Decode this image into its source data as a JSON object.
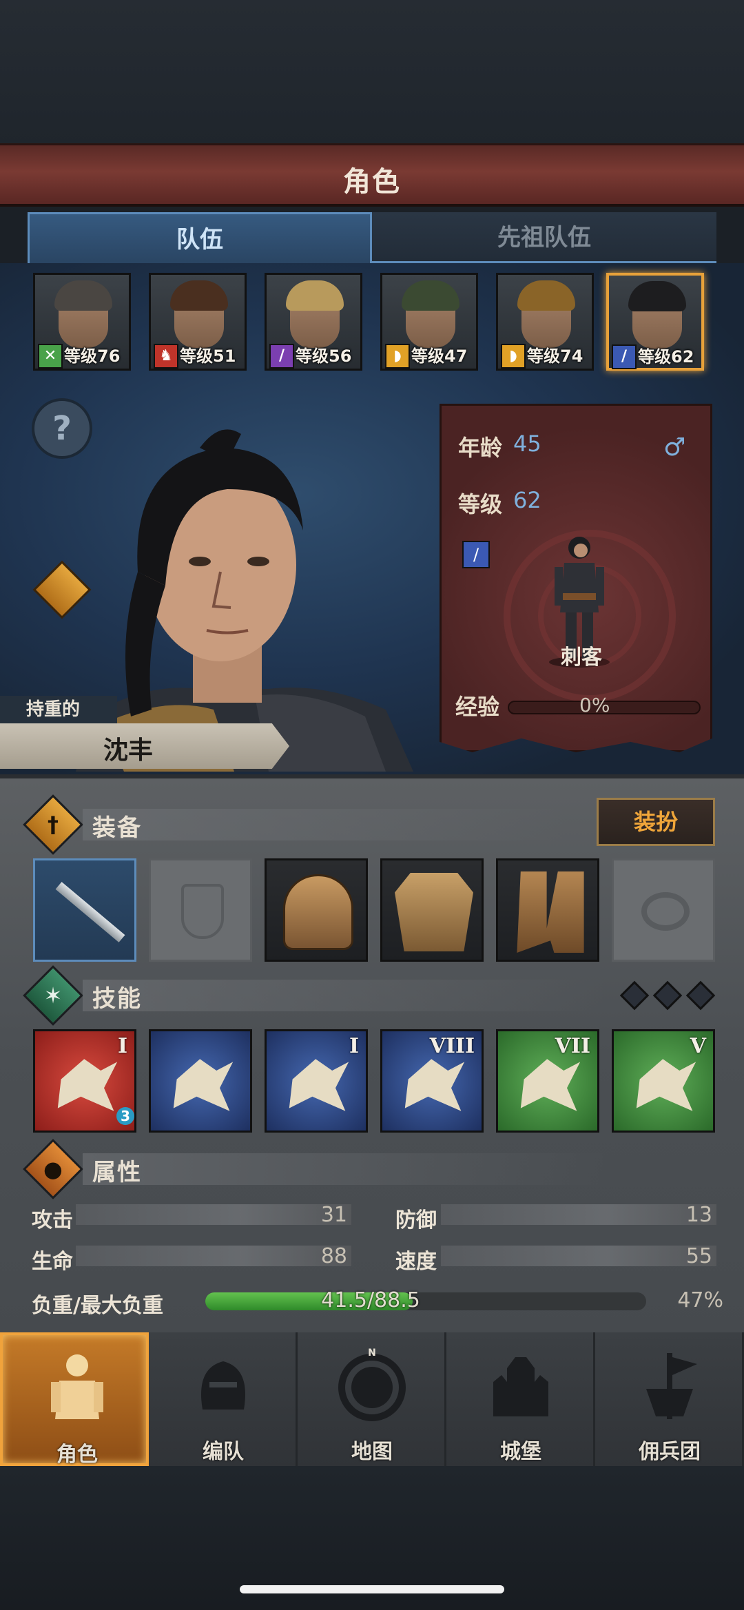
{
  "header": {
    "title": "角色"
  },
  "tabs": [
    {
      "label": "队伍",
      "active": true
    },
    {
      "label": "先祖队伍",
      "active": false
    }
  ],
  "roster": [
    {
      "level_text": "等级76",
      "class_icon": "crossed-swords-icon",
      "class_color": "#49a24a",
      "hair": "#4a4642",
      "selected": false
    },
    {
      "level_text": "等级51",
      "class_icon": "horse-icon",
      "class_color": "#c0342a",
      "hair": "#4a2f1f",
      "selected": false
    },
    {
      "level_text": "等级56",
      "class_icon": "staff-icon",
      "class_color": "#7b3fb0",
      "hair": "#b89a5c",
      "selected": false
    },
    {
      "level_text": "等级47",
      "class_icon": "shield-icon",
      "class_color": "#e1a126",
      "hair": "#3b4a32",
      "selected": false
    },
    {
      "level_text": "等级74",
      "class_icon": "shield-icon",
      "class_color": "#e1a126",
      "hair": "#8a6428",
      "selected": false
    },
    {
      "level_text": "等级62",
      "class_icon": "dagger-icon",
      "class_color": "#3b59b3",
      "hair": "#1d1d1f",
      "selected": true
    }
  ],
  "character": {
    "trait": "持重的",
    "name": "沈丰",
    "age_label": "年龄",
    "age": "45",
    "level_label": "等级",
    "level": "62",
    "gender_icon": "male-icon",
    "class_name": "刺客",
    "exp_label": "经验",
    "exp_value": "0%"
  },
  "equipment": {
    "title": "装备",
    "outfit_button": "装扮",
    "slots": [
      {
        "name": "dagger-icon",
        "state": "selected"
      },
      {
        "name": "shield-slot-icon",
        "state": "empty"
      },
      {
        "name": "helmet-icon",
        "state": "filled"
      },
      {
        "name": "armor-icon",
        "state": "filled"
      },
      {
        "name": "boots-icon",
        "state": "filled"
      },
      {
        "name": "ring-slot-icon",
        "state": "empty"
      }
    ]
  },
  "skills": {
    "title": "技能",
    "items": [
      {
        "rank": "I",
        "color": "red",
        "badge": "3"
      },
      {
        "rank": "",
        "color": "blue",
        "badge": ""
      },
      {
        "rank": "I",
        "color": "blue",
        "badge": ""
      },
      {
        "rank": "VIII",
        "color": "blue",
        "badge": ""
      },
      {
        "rank": "VII",
        "color": "green",
        "badge": ""
      },
      {
        "rank": "V",
        "color": "green",
        "badge": ""
      }
    ]
  },
  "attributes": {
    "title": "属性",
    "attack_label": "攻击",
    "attack": "31",
    "defense_label": "防御",
    "defense": "13",
    "health_label": "生命",
    "health": "88",
    "speed_label": "速度",
    "speed": "55",
    "load_label": "负重/最大负重",
    "load_text": "41.5/88.5",
    "load_percent_text": "47%",
    "load_fraction": 0.47
  },
  "nav": [
    {
      "label": "角色",
      "icon": "knight-icon",
      "active": true
    },
    {
      "label": "编队",
      "icon": "helmet-formation-icon",
      "active": false
    },
    {
      "label": "地图",
      "icon": "compass-map-icon",
      "active": false
    },
    {
      "label": "城堡",
      "icon": "castle-icon",
      "active": false
    },
    {
      "label": "佣兵团",
      "icon": "mercenary-banner-icon",
      "active": false
    }
  ]
}
